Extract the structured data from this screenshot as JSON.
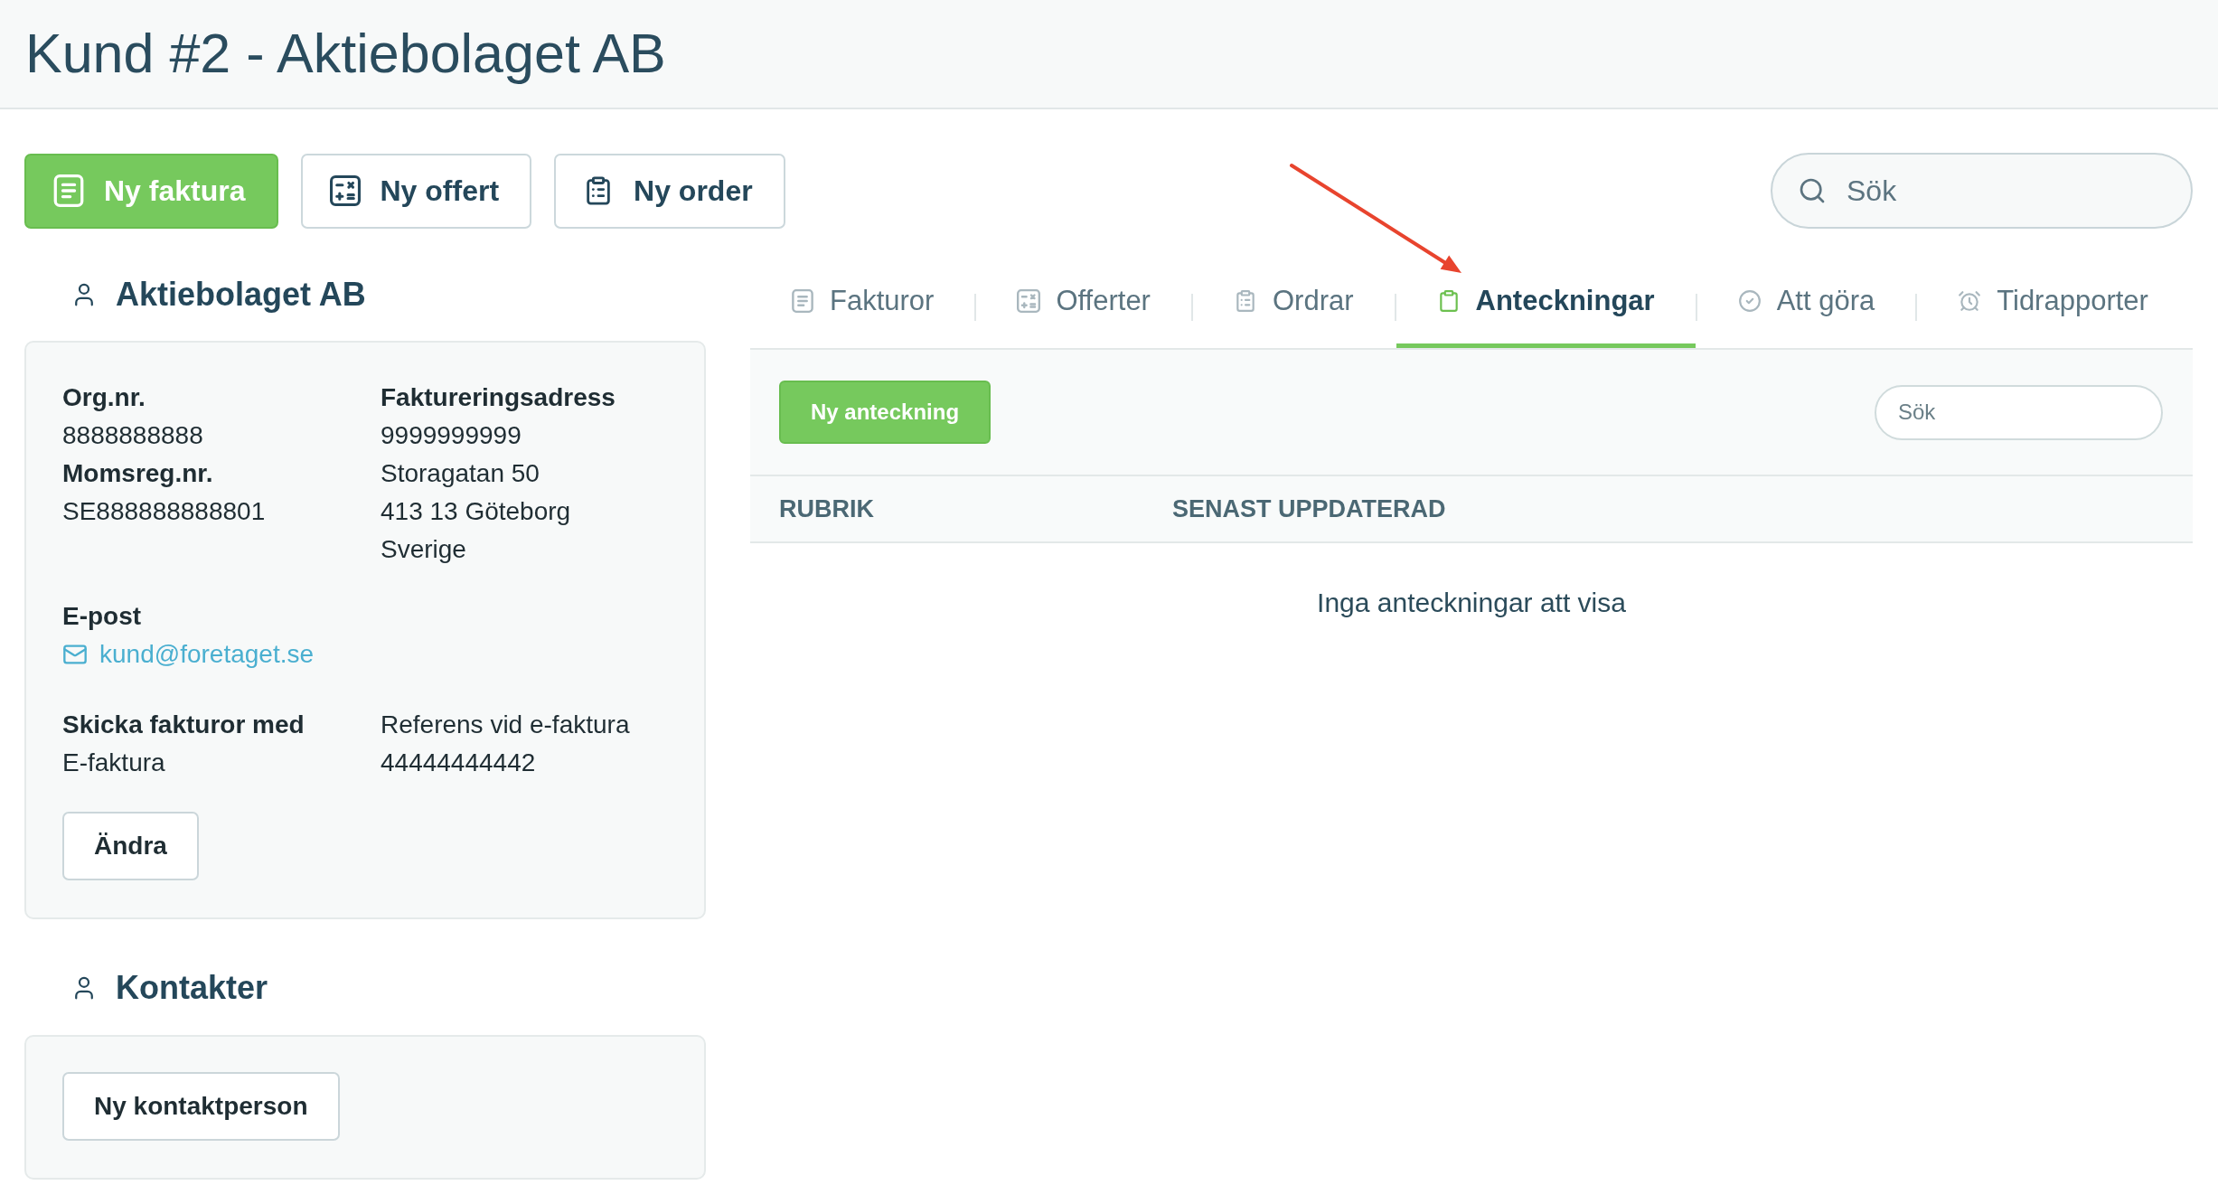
{
  "page_title": "Kund #2 - Aktiebolaget AB",
  "actions": [
    {
      "label": "Ny faktura",
      "kind": "primary"
    },
    {
      "label": "Ny offert",
      "kind": "outline"
    },
    {
      "label": "Ny order",
      "kind": "outline"
    }
  ],
  "search": {
    "placeholder": "Sök"
  },
  "customer": {
    "heading": "Aktiebolaget AB",
    "ids": [
      {
        "label": "Org.nr.",
        "value": "8888888888"
      },
      {
        "label": "Momsreg.nr.",
        "value": "SE888888888801"
      }
    ],
    "billing_address": {
      "label": "Faktureringsadress",
      "lines": [
        "9999999999",
        "Storagatan 50",
        "413 13 Göteborg",
        "Sverige"
      ]
    },
    "email": {
      "label": "E-post",
      "value": "kund@foretaget.se"
    },
    "invoicing": {
      "label": "Skicka fakturor med",
      "value": "E-faktura",
      "reference_lines": [
        "Referens vid e-faktura",
        "44444444442"
      ]
    },
    "edit_button": "Ändra"
  },
  "contacts": {
    "heading": "Kontakter",
    "new_button": "Ny kontaktperson"
  },
  "tabs": [
    {
      "label": "Fakturor",
      "selected": false
    },
    {
      "label": "Offerter",
      "selected": false
    },
    {
      "label": "Ordrar",
      "selected": false
    },
    {
      "label": "Anteckningar",
      "selected": true
    },
    {
      "label": "Att göra",
      "selected": false
    },
    {
      "label": "Tidrapporter",
      "selected": false
    }
  ],
  "notes": {
    "new_button": "Ny anteckning",
    "search": {
      "placeholder": "Sök"
    },
    "table": {
      "columns": [
        "RUBRIK",
        "SENAST UPPDATERAD"
      ],
      "empty_message": "Inga anteckningar att visa"
    }
  }
}
